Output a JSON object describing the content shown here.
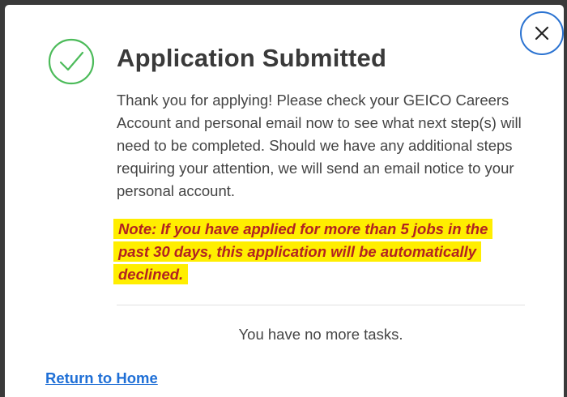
{
  "dialog": {
    "title": "Application Submitted",
    "message": "Thank you for applying! Please check your GEICO Careers Account and personal email now to see what next step(s) will need to be completed. Should we have any additional steps requiring your attention, we will send an email notice to your personal account.",
    "note": "Note: If you have applied for more than 5 jobs in the past 30 days, this application will be automatically declined.",
    "tasks_status": "You have no more tasks.",
    "return_link": "Return to Home",
    "icons": {
      "success": "check-circle-icon",
      "close": "close-icon"
    }
  },
  "colors": {
    "success_green": "#4cbb5a",
    "close_ring_blue": "#2b73d1",
    "note_text": "#b22222",
    "note_highlight": "#ffee00",
    "link_blue": "#1f6fd6"
  }
}
